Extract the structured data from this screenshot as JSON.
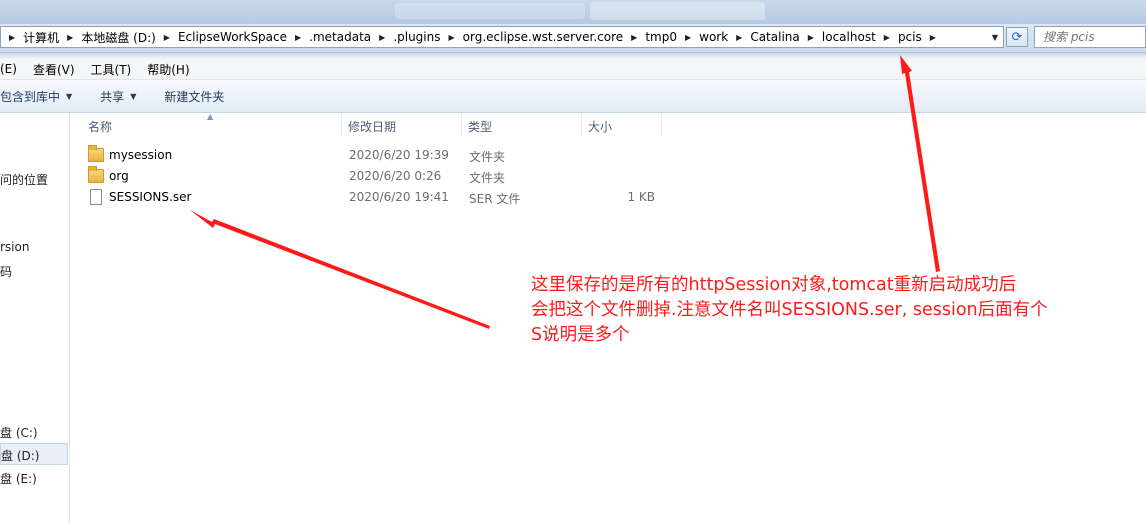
{
  "address_bar": {
    "crumbs": [
      "计算机",
      "本地磁盘 (D:)",
      "EclipseWorkSpace",
      ".metadata",
      ".plugins",
      "org.eclipse.wst.server.core",
      "tmp0",
      "work",
      "Catalina",
      "localhost",
      "pcis"
    ],
    "search_placeholder": "搜索 pcis"
  },
  "menu": [
    "(E)",
    "查看(V)",
    "工具(T)",
    "帮助(H)"
  ],
  "toolbar": {
    "include_library": "包含到库中",
    "share": "共享",
    "new_folder": "新建文件夹"
  },
  "nav": {
    "recent_places": "问的位置",
    "item_version": "rsion",
    "item_code": "码",
    "drive_c": "盘 (C:)",
    "drive_d": "盘 (D:)",
    "drive_e": "盘 (E:)"
  },
  "columns": {
    "name": "名称",
    "modified": "修改日期",
    "type": "类型",
    "size": "大小"
  },
  "files": [
    {
      "name": "mysession",
      "modified": "2020/6/20 19:39",
      "type": "文件夹",
      "size": "",
      "icon": "folder-icon"
    },
    {
      "name": "org",
      "modified": "2020/6/20 0:26",
      "type": "文件夹",
      "size": "",
      "icon": "folder-icon"
    },
    {
      "name": "SESSIONS.ser",
      "modified": "2020/6/20 19:41",
      "type": "SER 文件",
      "size": "1 KB",
      "icon": "file-icon"
    }
  ],
  "annotation": {
    "line1": "这里保存的是所有的httpSession对象,tomcat重新启动成功后",
    "line2": "会把这个文件删掉.注意文件名叫SESSIONS.ser, session后面有个",
    "line3": "S说明是多个",
    "color": "#ff1a1a"
  }
}
